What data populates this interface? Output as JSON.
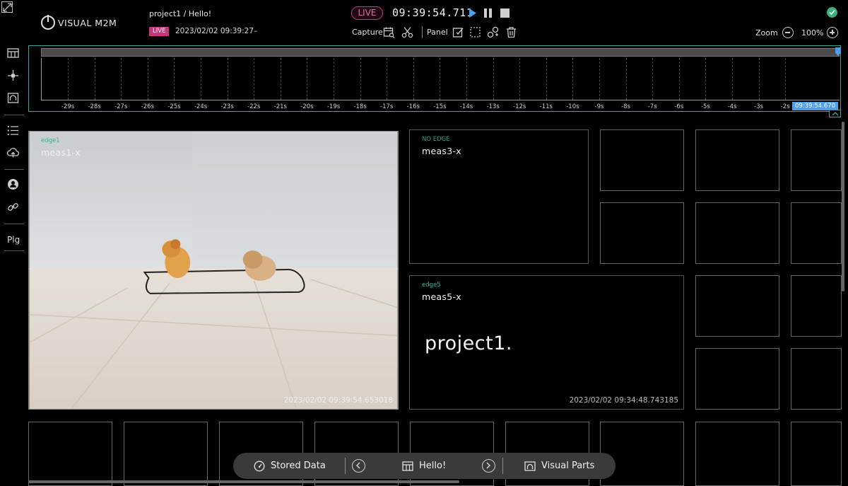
{
  "header": {
    "brand": "VISUAL M2M",
    "breadcrumb": "project1 / Hello!",
    "live_badge": "LIVE",
    "live_datetime": "2023/02/02 09:39:27–",
    "live_pill": "LIVE",
    "clock": "09:39:54.711",
    "capture_label": "Capture",
    "panel_label": "Panel",
    "zoom_label": "Zoom",
    "zoom_value": "100%",
    "accent_color": "#4d9fe8",
    "live_color": "#c3377d",
    "status_color": "#3bb07a"
  },
  "sidebar": {
    "items": [
      "dashboard-icon",
      "hierarchy-icon",
      "visual-parts-icon",
      "list-icon",
      "cloud-upload-icon",
      "user-icon",
      "link-icon"
    ],
    "plugin_label": "Plg"
  },
  "timeline": {
    "ticks": [
      "-29s",
      "-28s",
      "-27s",
      "-26s",
      "-25s",
      "-24s",
      "-23s",
      "-22s",
      "-21s",
      "-20s",
      "-19s",
      "-18s",
      "-17s",
      "-16s",
      "-15s",
      "-14s",
      "-13s",
      "-12s",
      "-11s",
      "-10s",
      "-9s",
      "-8s",
      "-7s",
      "-6s",
      "-5s",
      "-4s",
      "-3s",
      "-2s"
    ],
    "current_time": "09:39:54.670"
  },
  "panels": {
    "camera": {
      "edge": "edge1",
      "meas": "meas1-x",
      "timestamp": "2023/02/02 09:39:54.653018"
    },
    "meas3": {
      "edge": "NO EDGE",
      "meas": "meas3-x"
    },
    "meas5": {
      "edge": "edge5",
      "meas": "meas5-x",
      "text": "project1.",
      "timestamp": "2023/02/02 09:34:48.743185"
    }
  },
  "bottombar": {
    "stored_data": "Stored Data",
    "dashboard": "Hello!",
    "visual_parts": "Visual Parts"
  }
}
